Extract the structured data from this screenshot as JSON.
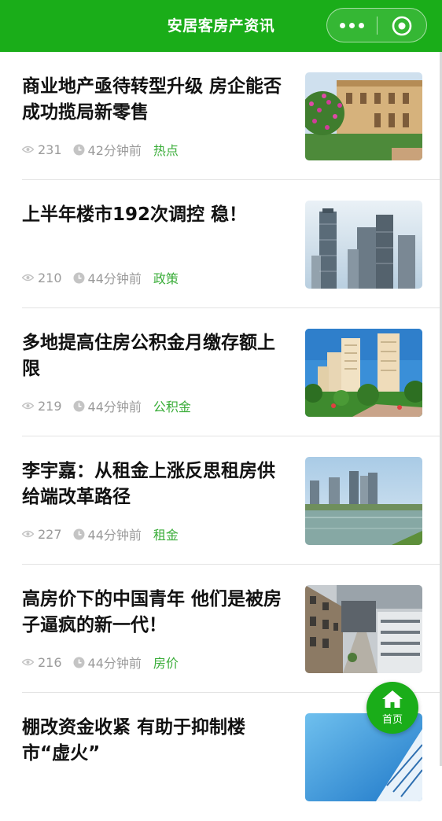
{
  "nav": {
    "title": "安居客房产资讯"
  },
  "articles": [
    {
      "title": "商业地产亟待转型升级 房企能否成功揽局新零售",
      "views": "231",
      "time": "42分钟前",
      "tag": "热点",
      "image": "villa-with-flowers"
    },
    {
      "title": "上半年楼市192次调控 稳！",
      "views": "210",
      "time": "44分钟前",
      "tag": "政策",
      "image": "skyscrapers"
    },
    {
      "title": "多地提高住房公积金月缴存额上限",
      "views": "219",
      "time": "44分钟前",
      "tag": "公积金",
      "image": "residential-towers-park"
    },
    {
      "title": "李宇嘉：从租金上涨反思租房供给端改革路径",
      "views": "227",
      "time": "44分钟前",
      "tag": "租金",
      "image": "waterfront-towers"
    },
    {
      "title": "高房价下的中国青年 他们是被房子逼疯的新一代！",
      "views": "216",
      "time": "44分钟前",
      "tag": "房价",
      "image": "street-buildings"
    },
    {
      "title": "棚改资金收紧 有助于抑制楼市“虚火”",
      "views": "",
      "time": "",
      "tag": "",
      "image": "glass-building"
    }
  ],
  "fab": {
    "label": "首页",
    "icon": "home-icon"
  },
  "colors": {
    "brand": "#1aad19",
    "tag": "#3aad39",
    "meta": "#9a9a9a"
  }
}
